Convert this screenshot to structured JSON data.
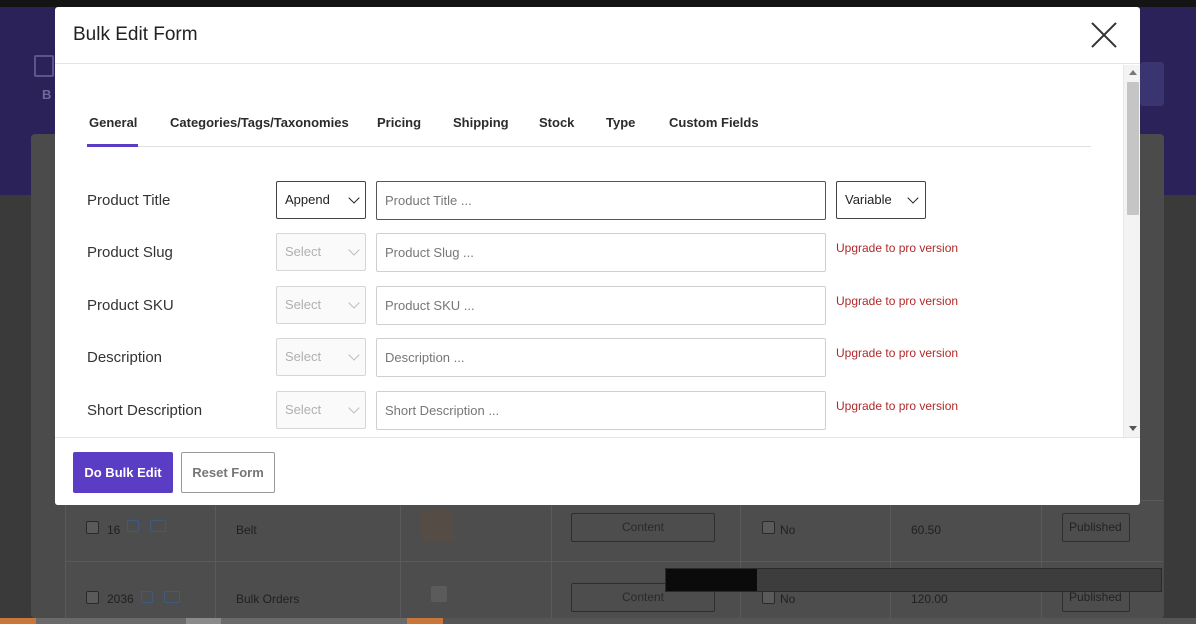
{
  "background": {
    "header_truncated": "B",
    "rows": [
      {
        "id": "16",
        "name": "Belt",
        "content_label": "Content",
        "flag": "No",
        "price": "60.50",
        "status": "Published"
      },
      {
        "id": "2036",
        "name": "Bulk Orders",
        "content_label": "Content",
        "flag": "No",
        "price": "120.00",
        "status": "Published"
      }
    ]
  },
  "modal": {
    "title": "Bulk Edit Form",
    "tabs": [
      {
        "label": "General"
      },
      {
        "label": "Categories/Tags/Taxonomies"
      },
      {
        "label": "Pricing"
      },
      {
        "label": "Shipping"
      },
      {
        "label": "Stock"
      },
      {
        "label": "Type"
      },
      {
        "label": "Custom Fields"
      }
    ],
    "rows": [
      {
        "label": "Product Title",
        "select": "Append",
        "placeholder": "Product Title ...",
        "extra": "Variable"
      },
      {
        "label": "Product Slug",
        "select": "Select",
        "placeholder": "Product Slug ...",
        "extra": "Upgrade to pro version"
      },
      {
        "label": "Product SKU",
        "select": "Select",
        "placeholder": "Product SKU ...",
        "extra": "Upgrade to pro version"
      },
      {
        "label": "Description",
        "select": "Select",
        "placeholder": "Description ...",
        "extra": "Upgrade to pro version"
      },
      {
        "label": "Short Description",
        "select": "Select",
        "placeholder": "Short Description ...",
        "extra": "Upgrade to pro version"
      }
    ],
    "footer": {
      "primary_label": "Do Bulk Edit",
      "secondary_label": "Reset Form"
    }
  },
  "colors": {
    "accent": "#5b3cc4",
    "upgrade_text": "#b02a2a"
  }
}
